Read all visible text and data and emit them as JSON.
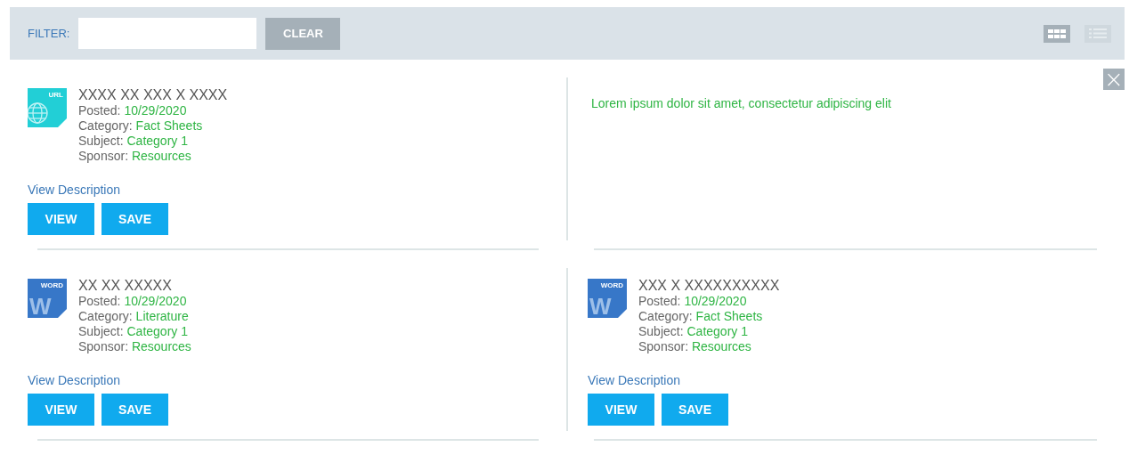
{
  "toolbar": {
    "filter_label": "FILTER:",
    "clear_button": "CLEAR",
    "view_modes": [
      {
        "kind": "grid",
        "selected": true
      },
      {
        "kind": "list",
        "selected": false
      }
    ]
  },
  "close_button": {
    "label": "×"
  },
  "cards": [
    {
      "kind": "document",
      "icon": {
        "kind": "url",
        "badge": "URL"
      },
      "title": "XXXX XX XXX X XXXX",
      "fields": [
        {
          "label": "Posted:",
          "value": "10/29/2020"
        },
        {
          "label": "Category:",
          "value": "Fact Sheets"
        },
        {
          "label": "Subject:",
          "value": "Category 1"
        },
        {
          "label": "Sponsor:",
          "value": "Resources"
        }
      ],
      "link": "View Description",
      "buttons": [
        "VIEW",
        "SAVE"
      ]
    },
    {
      "kind": "description",
      "text": "Lorem ipsum dolor sit amet, consectetur adipiscing elit"
    },
    {
      "kind": "document",
      "icon": {
        "kind": "word",
        "badge": "WORD",
        "letter": "W"
      },
      "title": "XX XX XXXXX",
      "fields": [
        {
          "label": "Posted:",
          "value": "10/29/2020"
        },
        {
          "label": "Category:",
          "value": "Literature"
        },
        {
          "label": "Subject:",
          "value": "Category 1"
        },
        {
          "label": "Sponsor:",
          "value": "Resources"
        }
      ],
      "link": "View Description",
      "buttons": [
        "VIEW",
        "SAVE"
      ]
    },
    {
      "kind": "document",
      "icon": {
        "kind": "word",
        "badge": "WORD",
        "letter": "W"
      },
      "title": "XXX X XXXXXXXXXX",
      "fields": [
        {
          "label": "Posted:",
          "value": "10/29/2020"
        },
        {
          "label": "Category:",
          "value": "Fact Sheets"
        },
        {
          "label": "Subject:",
          "value": "Category 1"
        },
        {
          "label": "Sponsor:",
          "value": "Resources"
        }
      ],
      "link": "View Description",
      "buttons": [
        "VIEW",
        "SAVE"
      ]
    }
  ]
}
